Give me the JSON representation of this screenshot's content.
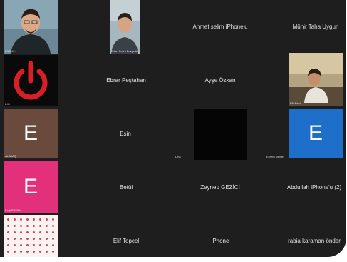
{
  "participants": [
    {
      "id": "p1",
      "name": "ENG-K...",
      "kind": "video",
      "bg": "#5f7c8e"
    },
    {
      "id": "p2",
      "name": "Ertan Selim Bozgedik",
      "kind": "video",
      "bg": "#8aa0ad"
    },
    {
      "id": "p3",
      "name": "Ahmet selim iPhone'u",
      "kind": "name"
    },
    {
      "id": "p4",
      "name": "Münir Taha Uygun",
      "kind": "name"
    },
    {
      "id": "p5",
      "name": "L.M",
      "kind": "power",
      "bg": "#0b0b0b",
      "accent": "#d81f24"
    },
    {
      "id": "p6",
      "name": "Ebrar Peştahan",
      "kind": "name"
    },
    {
      "id": "p7",
      "name": "Ayşe Özkan",
      "kind": "name"
    },
    {
      "id": "p8",
      "name": "Elif Nazlı",
      "kind": "video",
      "bg": "#b5a585"
    },
    {
      "id": "p9",
      "name": "ALAKAŞ",
      "kind": "letter",
      "letter": "E",
      "bg": "#6b4a3e"
    },
    {
      "id": "p10",
      "name": "Esin",
      "kind": "name"
    },
    {
      "id": "p11",
      "name": "Lina",
      "kind": "black"
    },
    {
      "id": "p12",
      "name": "Ekrem Memet",
      "kind": "letter",
      "letter": "E",
      "bg": "#1e6fc9"
    },
    {
      "id": "p13",
      "name": "Ezgi ERDEM",
      "kind": "letter",
      "letter": "E",
      "bg": "#e3307a"
    },
    {
      "id": "p14",
      "name": "Betül",
      "kind": "name"
    },
    {
      "id": "p15",
      "name": "Zeynep GEZİCİ",
      "kind": "name"
    },
    {
      "id": "p16",
      "name": "Abdullah iPhone'u (2)",
      "kind": "name"
    },
    {
      "id": "p17",
      "name": "",
      "kind": "pattern"
    },
    {
      "id": "p18",
      "name": "Elif Topcel",
      "kind": "name"
    },
    {
      "id": "p19",
      "name": "iPhone",
      "kind": "name"
    },
    {
      "id": "p20",
      "name": "rabia karaman önder",
      "kind": "name"
    }
  ]
}
